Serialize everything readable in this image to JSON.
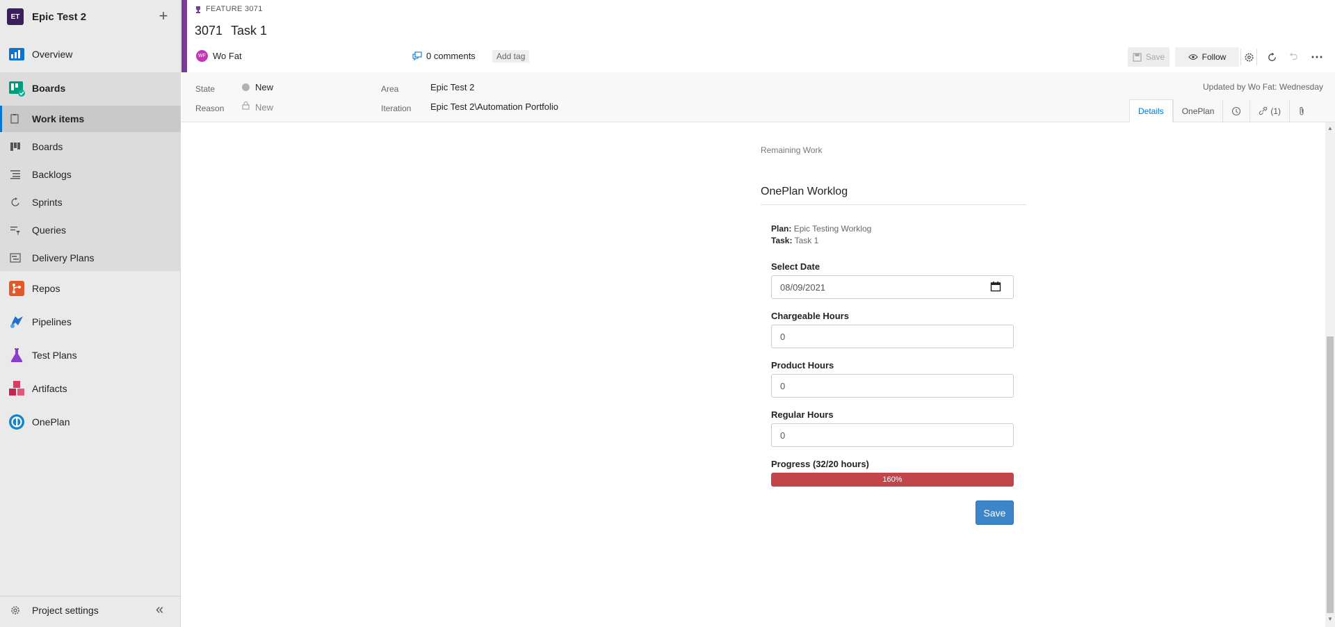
{
  "project": {
    "avatar": "ET",
    "name": "Epic Test 2"
  },
  "nav": {
    "overview": "Overview",
    "boards": "Boards",
    "boards_sub": [
      "Work items",
      "Boards",
      "Backlogs",
      "Sprints",
      "Queries",
      "Delivery Plans"
    ],
    "repos": "Repos",
    "pipelines": "Pipelines",
    "test_plans": "Test Plans",
    "artifacts": "Artifacts",
    "oneplan": "OnePlan",
    "project_settings": "Project settings"
  },
  "work_item": {
    "type_label": "FEATURE 3071",
    "id": "3071",
    "title": "Task 1",
    "assignee_initials": "WF",
    "assignee": "Wo Fat",
    "comments": "0 comments",
    "add_tag": "Add tag",
    "toolbar": {
      "save": "Save",
      "follow": "Follow"
    },
    "fields": {
      "state_label": "State",
      "state_value": "New",
      "reason_label": "Reason",
      "reason_value": "New",
      "area_label": "Area",
      "area_value": "Epic Test 2",
      "iteration_label": "Iteration",
      "iteration_value": "Epic Test 2\\Automation Portfolio"
    },
    "updated": "Updated by Wo Fat: Wednesday",
    "tabs": {
      "details": "Details",
      "oneplan": "OnePlan",
      "links": "(1)"
    }
  },
  "worklog": {
    "remaining_work_label": "Remaining Work",
    "section_title": "OnePlan Worklog",
    "plan_label": "Plan:",
    "plan_value": "Epic Testing Worklog",
    "task_label": "Task:",
    "task_value": "Task 1",
    "select_date_label": "Select Date",
    "select_date_value": "08/09/2021",
    "chargeable_label": "Chargeable Hours",
    "chargeable_value": "0",
    "product_label": "Product Hours",
    "product_value": "0",
    "regular_label": "Regular Hours",
    "regular_value": "0",
    "progress_label": "Progress (32/20 hours)",
    "progress_text": "160%",
    "progress_percent": 160,
    "save_label": "Save"
  },
  "colors": {
    "accent": "#773b93",
    "progress_fill": "#c1454a",
    "save_button": "#3b86c9",
    "link": "#0078d4"
  }
}
